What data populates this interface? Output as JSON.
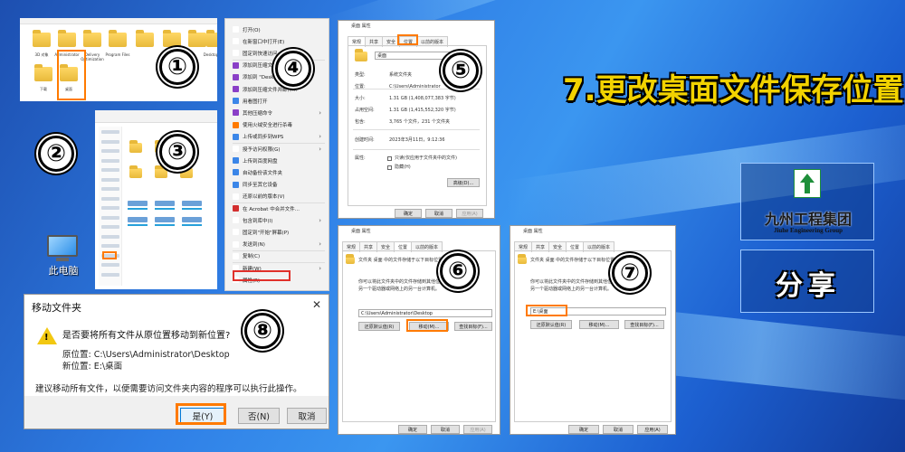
{
  "title": "7.更改桌面文件保存位置",
  "steps": [
    "①",
    "②",
    "③",
    "④",
    "⑤",
    "⑥",
    "⑦",
    "⑧"
  ],
  "colors": {
    "accent": "#ff7a00",
    "desktop_blue": "#2f7fe6",
    "title_yellow": "#f2d200"
  },
  "desktop": {
    "pc_label": "此电脑",
    "pc_icon": "monitor-icon"
  },
  "brand": {
    "cn": "九州工程集团",
    "en": "Jiuhe Engineering Group",
    "logo_icon": "company-logo-icon"
  },
  "share_label": "分享",
  "explorer_panel": {
    "folders": [
      {
        "label": "3D 对象"
      },
      {
        "label": "Administrator"
      },
      {
        "label": "Delivery Optimization"
      },
      {
        "label": "Program Files"
      },
      {
        "label": ""
      },
      {
        "label": ""
      },
      {
        "label": ""
      },
      {
        "label": "DesktopApps"
      }
    ],
    "row2": [
      {
        "label": "下载"
      },
      {
        "label": "桌面"
      }
    ]
  },
  "context_menu": {
    "items": [
      {
        "label": "打开(O)",
        "submenu": false
      },
      {
        "label": "在新窗口中打开(E)",
        "submenu": false
      },
      {
        "label": "固定到快速访问",
        "submenu": false
      },
      {
        "label": "添加到压缩文件(A)...",
        "submenu": false
      },
      {
        "label": "添加到 \"Desktop.rar\"(T)",
        "submenu": false
      },
      {
        "label": "添加到压缩文件并邮件...",
        "submenu": false
      },
      {
        "label": "用看图打开",
        "submenu": false
      },
      {
        "label": "其他压缩命令",
        "submenu": true
      },
      {
        "label": "使用火绒安全进行杀毒",
        "submenu": false
      },
      {
        "label": "上传或同步到WPS",
        "submenu": true
      },
      {
        "label": "授予访问权限(G)",
        "submenu": true
      },
      {
        "label": "上传到百度网盘",
        "submenu": false
      },
      {
        "label": "自动备份该文件夹",
        "submenu": false
      },
      {
        "label": "同步至其它设备",
        "submenu": false
      },
      {
        "label": "还原以前的版本(V)",
        "submenu": false
      },
      {
        "label": "在 Acrobat 中合并文件...",
        "submenu": false
      },
      {
        "label": "包含到库中(I)",
        "submenu": true
      },
      {
        "label": "固定到\"开始\"屏幕(P)",
        "submenu": false
      },
      {
        "label": "发送到(N)",
        "submenu": true
      },
      {
        "label": "复制(C)",
        "submenu": false
      },
      {
        "label": "新建(W)",
        "submenu": true
      },
      {
        "label": "属性(R)",
        "submenu": false
      }
    ]
  },
  "props_general": {
    "title": "桌面 属性",
    "tabs": [
      "常规",
      "共享",
      "安全",
      "位置",
      "以前的版本"
    ],
    "name_value": "桌面",
    "rows": [
      {
        "k": "类型:",
        "v": "系统文件夹"
      },
      {
        "k": "位置:",
        "v": "C:\\Users\\Administrator"
      },
      {
        "k": "大小:",
        "v": "1.31 GB (1,408,077,383 字节)"
      },
      {
        "k": "占用空间:",
        "v": "1.31 GB (1,415,552,320 字节)"
      },
      {
        "k": "包含:",
        "v": "3,765 个文件，231 个文件夹"
      },
      {
        "k": "创建时间:",
        "v": "2023年3月11日，9:12:36"
      },
      {
        "k": "属性:",
        "v": "只读(仅应用于文件夹中的文件)"
      },
      {
        "k": "",
        "v": "隐藏(H)"
      }
    ],
    "advanced": "高级(D)...",
    "ok": "确定",
    "cancel": "取消",
    "apply": "应用(A)"
  },
  "props_location_a": {
    "title": "桌面 属性",
    "tabs": [
      "常规",
      "共享",
      "安全",
      "位置",
      "以前的版本"
    ],
    "desc1": "文件夹 桌面 中的文件存储于以下目标位置。",
    "desc2a": "你可以将此文件夹中的文件存储到其他位置，",
    "desc2b": "另一个驱动器或网络上的另一台计算机。",
    "path": "C:\\Users\\Administrator\\Desktop",
    "restore": "还原默认值(R)",
    "move": "移动(M)...",
    "find": "查找目标(F)...",
    "ok": "确定",
    "cancel": "取消",
    "apply": "应用(A)"
  },
  "props_location_b": {
    "title": "桌面 属性",
    "tabs": [
      "常规",
      "共享",
      "安全",
      "位置",
      "以前的版本"
    ],
    "desc1": "文件夹 桌面 中的文件存储于以下目标位置。",
    "desc2a": "你可以将此文件夹中的文件存储到其他位置，",
    "desc2b": "另一个驱动器或网络上的另一台计算机。",
    "path": "E:\\桌面",
    "restore": "还原默认值(R)",
    "move": "移动(M)...",
    "find": "查找目标(F)...",
    "ok": "确定",
    "cancel": "取消",
    "apply": "应用(A)"
  },
  "move_dialog": {
    "title": "移动文件夹",
    "close": "✕",
    "question": "是否要将所有文件从原位置移动到新位置?",
    "orig": "原位置: C:\\Users\\Administrator\\Desktop",
    "new": "新位置: E:\\桌面",
    "advice": "建议移动所有文件，以便需要访问文件夹内容的程序可以执行此操作。",
    "yes": "是(Y)",
    "no": "否(N)",
    "cancel": "取消"
  }
}
